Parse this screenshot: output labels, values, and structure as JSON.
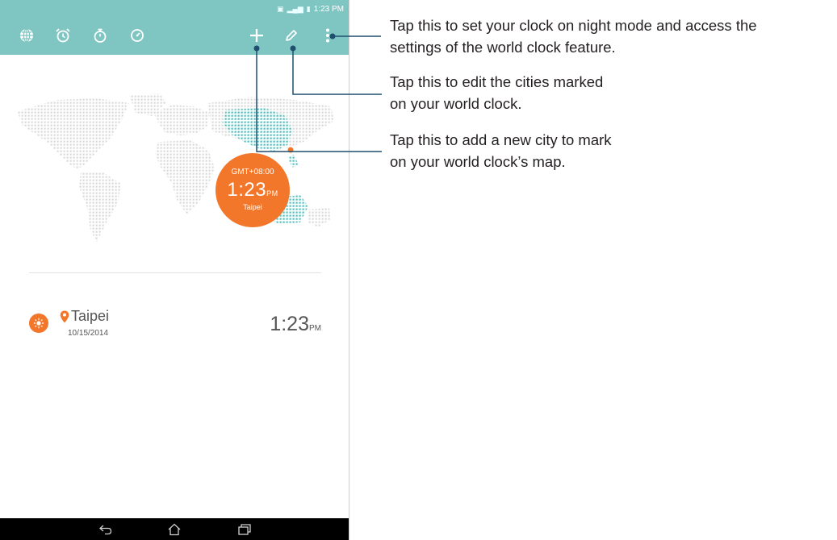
{
  "status_bar": {
    "time": "1:23 PM",
    "icons": [
      "sim-icon",
      "signal-icon",
      "battery-icon"
    ]
  },
  "toolbar": {
    "tabs": [
      {
        "name": "world-clock-tab",
        "icon": "globe-icon"
      },
      {
        "name": "alarm-tab",
        "icon": "alarm-clock-icon"
      },
      {
        "name": "stopwatch-tab",
        "icon": "stopwatch-icon"
      },
      {
        "name": "timer-tab",
        "icon": "timer-icon"
      }
    ],
    "actions": [
      {
        "name": "add-city-button",
        "icon": "plus-icon"
      },
      {
        "name": "edit-cities-button",
        "icon": "pencil-icon"
      },
      {
        "name": "overflow-menu-button",
        "icon": "more-vertical-icon"
      }
    ]
  },
  "map_badge": {
    "timezone": "GMT+08:00",
    "time": "1:23",
    "ampm": "PM",
    "city": "Taipei"
  },
  "city_list": [
    {
      "name": "Taipei",
      "date": "10/15/2014",
      "time": "1:23",
      "ampm": "PM",
      "icon": "sun-icon"
    }
  ],
  "nav_bar": {
    "buttons": [
      "back-icon",
      "home-icon",
      "recent-apps-icon"
    ]
  },
  "callouts": [
    {
      "lines": [
        "Tap this to set your clock on night mode and access the",
        "settings of the world clock feature."
      ],
      "target": "overflow-menu-button"
    },
    {
      "lines": [
        "Tap this to edit the cities marked",
        "on your world clock."
      ],
      "target": "edit-cities-button"
    },
    {
      "lines": [
        "Tap this to add a new city to mark",
        "on your world clock’s map."
      ],
      "target": "add-city-button"
    }
  ],
  "colors": {
    "toolbar": "#7fc6c3",
    "accent": "#f3772b",
    "map_dots": "#d9d9d9",
    "highlight_region": "#4fc0bd",
    "nav_bar": "#000000",
    "callout_line": "#1f4e6e"
  }
}
